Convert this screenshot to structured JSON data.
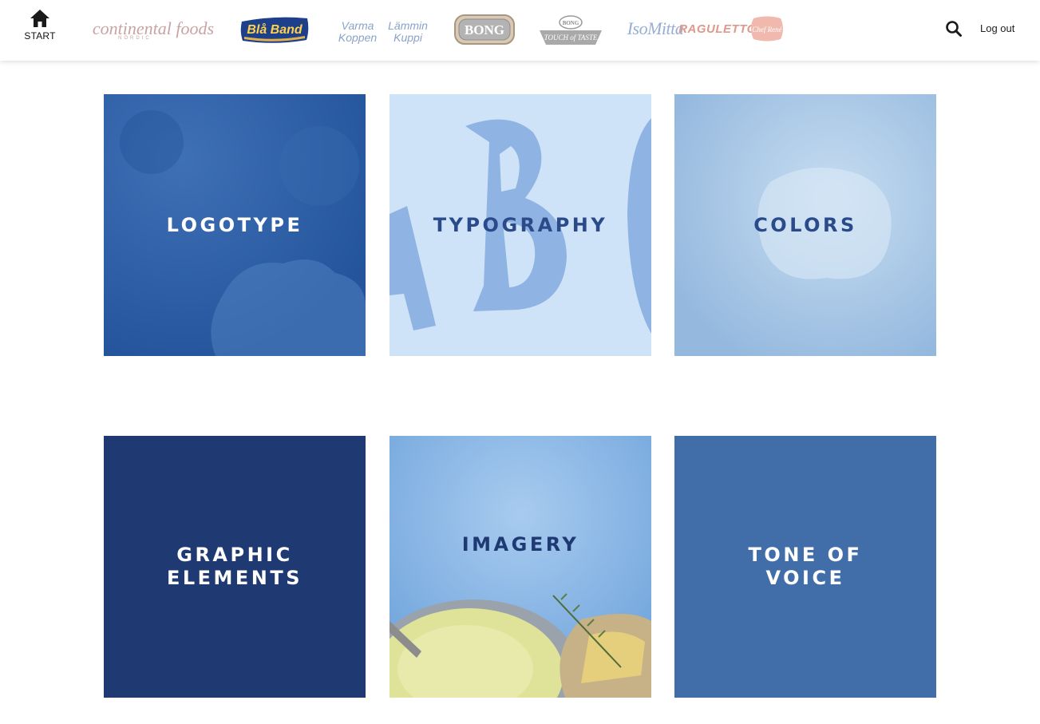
{
  "header": {
    "start_label": "START",
    "logout_label": "Log out",
    "brands": {
      "continental": "continental foods",
      "continental_sub": "NORDIC",
      "blaband": "Blå Band",
      "varma_koppen": "Varma Koppen",
      "lammin_kuppi": "Lämmin Kuppi",
      "bong": "BONG",
      "touch_top": "BONG",
      "touch_of_taste": "TOUCH of TASTE",
      "isomitta": "IsoMitta",
      "raguletto": "RAGULETTO",
      "chef_rene": "Chef René"
    }
  },
  "tiles": [
    {
      "label": "LOGOTYPE"
    },
    {
      "label": "TYPOGRAPHY"
    },
    {
      "label": "COLORS"
    },
    {
      "label": "GRAPHIC\nELEMENTS"
    },
    {
      "label": "IMAGERY"
    },
    {
      "label": "TONE OF\nVOICE"
    }
  ],
  "colors": {
    "logotype_bg": "#2c5fa6",
    "typography_bg": "#cfe3f8",
    "colors_bg": "#a6c6e6",
    "graphic_bg": "#1f3a73",
    "imagery_bg": "#7fb0e4",
    "tone_bg": "#416ea8",
    "heading_navy": "#2b4a8a"
  }
}
